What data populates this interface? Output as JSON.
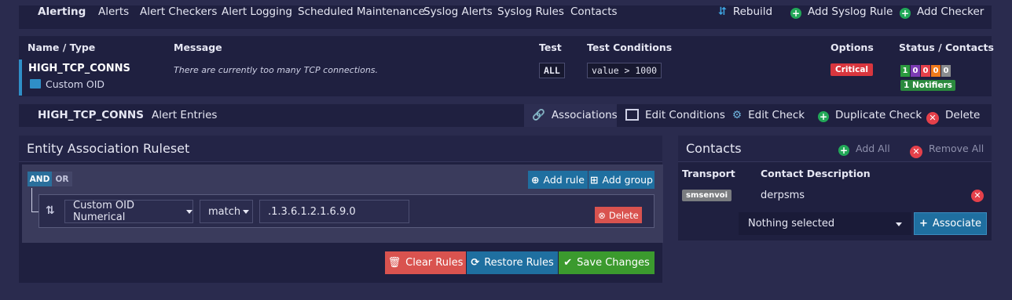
{
  "nav": {
    "title": "Alerting",
    "items": [
      "Alerts",
      "Alert Checkers",
      "Alert Logging",
      "Scheduled Maintenance",
      "Syslog Alerts",
      "Syslog Rules",
      "Contacts"
    ],
    "rebuild": "Rebuild",
    "add_syslog_rule": "Add Syslog Rule",
    "add_checker": "Add Checker"
  },
  "alert_table": {
    "headers": [
      "Name / Type",
      "Message",
      "Test",
      "Test Conditions",
      "Options",
      "Status / Contacts"
    ],
    "row": {
      "name": "HIGH_TCP_CONNS",
      "type": "Custom OID",
      "message": "There are currently too many TCP connections.",
      "test": "ALL",
      "condition": "value > 1000",
      "option": "Critical",
      "status_counts": [
        "1",
        "0",
        "0",
        "0",
        "0"
      ],
      "status_colors": [
        "#2b9a3e",
        "#7c3bb3",
        "#e5404a",
        "#f07a1a",
        "#8a8c8e"
      ],
      "notifiers": "1 Notifiers"
    }
  },
  "subnav": {
    "name": "HIGH_TCP_CONNS",
    "alert_entries": "Alert Entries",
    "associations": "Associations",
    "edit_conditions": "Edit Conditions",
    "edit_check": "Edit Check",
    "duplicate_check": "Duplicate Check",
    "delete": "Delete"
  },
  "ruleset": {
    "title": "Entity Association Ruleset",
    "and": "AND",
    "or": "OR",
    "add_rule": "Add rule",
    "add_group": "Add group",
    "field": "Custom OID Numerical",
    "operator": "match",
    "value": ".1.3.6.1.2.1.6.9.0",
    "delete_rule": "Delete",
    "clear_rules": "Clear Rules",
    "restore_rules": "Restore Rules",
    "save_changes": "Save Changes"
  },
  "contacts": {
    "title": "Contacts",
    "add_all": "Add All",
    "remove_all": "Remove All",
    "col_transport": "Transport",
    "col_description": "Contact Description",
    "transport": "smsenvoi",
    "description": "derpsms",
    "select_placeholder": "Nothing selected",
    "associate": "Associate"
  },
  "colors": {
    "background": "#2a2b4e",
    "panel": "#1f2040",
    "accent_blue": "#1f6fa0",
    "green": "#3b9a2e",
    "red": "#d9534f"
  }
}
